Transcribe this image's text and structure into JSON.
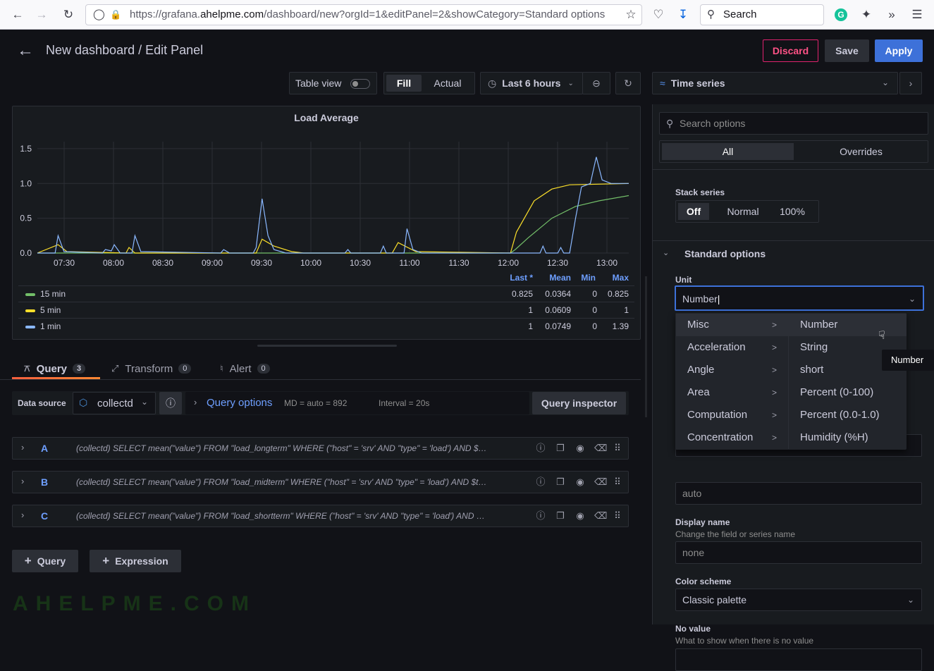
{
  "browser": {
    "url_prefix": "https://grafana.",
    "url_domain": "ahelpme.com",
    "url_path": "/dashboard/new?orgId=1&editPanel=2&showCategory=Standard options",
    "search_placeholder": "Search"
  },
  "header": {
    "title": "New dashboard / Edit Panel",
    "discard": "Discard",
    "save": "Save",
    "apply": "Apply"
  },
  "toolbar": {
    "table_view": "Table view",
    "fill": "Fill",
    "actual": "Actual",
    "time_range": "Last 6 hours",
    "visualization": "Time series"
  },
  "chart_data": {
    "type": "line",
    "title": "Load Average",
    "x_ticks": [
      "07:30",
      "08:00",
      "08:30",
      "09:00",
      "09:30",
      "10:00",
      "10:30",
      "11:00",
      "11:30",
      "12:00",
      "12:30",
      "13:00"
    ],
    "y_ticks": [
      "0.0",
      "0.5",
      "1.0",
      "1.5"
    ],
    "ylim": [
      0,
      1.6
    ],
    "grid": true,
    "legend_placement": "bottom",
    "legend_headers": [
      "Last *",
      "Mean",
      "Min",
      "Max"
    ],
    "series": [
      {
        "name": "15 min",
        "color": "#73bf69",
        "last": "0.825",
        "mean": "0.0364",
        "min": "0",
        "max": "0.825",
        "points": [
          [
            0,
            0
          ],
          [
            0.8,
            0
          ],
          [
            0.808,
            0.05
          ],
          [
            0.83,
            0.22
          ],
          [
            0.87,
            0.5
          ],
          [
            0.91,
            0.67
          ],
          [
            0.95,
            0.75
          ],
          [
            1,
            0.825
          ]
        ]
      },
      {
        "name": "5 min",
        "color": "#fade2a",
        "last": "1",
        "mean": "0.0609",
        "min": "0",
        "max": "1",
        "points": [
          [
            0,
            0
          ],
          [
            0.035,
            0.12
          ],
          [
            0.05,
            0.02
          ],
          [
            0.15,
            0
          ],
          [
            0.155,
            0.08
          ],
          [
            0.165,
            0
          ],
          [
            0.37,
            0
          ],
          [
            0.38,
            0.2
          ],
          [
            0.4,
            0.1
          ],
          [
            0.43,
            0.02
          ],
          [
            0.45,
            0
          ],
          [
            0.6,
            0
          ],
          [
            0.61,
            0.15
          ],
          [
            0.64,
            0.02
          ],
          [
            0.8,
            0
          ],
          [
            0.81,
            0.3
          ],
          [
            0.84,
            0.75
          ],
          [
            0.87,
            0.92
          ],
          [
            0.9,
            0.98
          ],
          [
            1,
            1
          ]
        ]
      },
      {
        "name": "1 min",
        "color": "#8ab8ff",
        "last": "1",
        "mean": "0.0749",
        "min": "0",
        "max": "1.39",
        "points": [
          [
            0,
            0
          ],
          [
            0.03,
            0
          ],
          [
            0.035,
            0.25
          ],
          [
            0.045,
            0.02
          ],
          [
            0.11,
            0
          ],
          [
            0.115,
            0.05
          ],
          [
            0.125,
            0.03
          ],
          [
            0.13,
            0.12
          ],
          [
            0.14,
            0
          ],
          [
            0.16,
            0
          ],
          [
            0.165,
            0.25
          ],
          [
            0.175,
            0.02
          ],
          [
            0.31,
            0
          ],
          [
            0.315,
            0.05
          ],
          [
            0.325,
            0
          ],
          [
            0.365,
            0
          ],
          [
            0.37,
            0.08
          ],
          [
            0.38,
            0.78
          ],
          [
            0.39,
            0.25
          ],
          [
            0.4,
            0.05
          ],
          [
            0.42,
            0
          ],
          [
            0.52,
            0
          ],
          [
            0.525,
            0.05
          ],
          [
            0.53,
            0
          ],
          [
            0.58,
            0
          ],
          [
            0.585,
            0.1
          ],
          [
            0.59,
            0
          ],
          [
            0.62,
            0
          ],
          [
            0.625,
            0.35
          ],
          [
            0.635,
            0.05
          ],
          [
            0.65,
            0
          ],
          [
            0.85,
            0
          ],
          [
            0.855,
            0.1
          ],
          [
            0.86,
            0
          ],
          [
            0.88,
            0
          ],
          [
            0.885,
            0.08
          ],
          [
            0.89,
            0
          ],
          [
            0.9,
            0
          ],
          [
            0.91,
            0.5
          ],
          [
            0.92,
            0.95
          ],
          [
            0.935,
            1.0
          ],
          [
            0.945,
            1.38
          ],
          [
            0.955,
            1.05
          ],
          [
            0.97,
            1.0
          ],
          [
            1,
            1.0
          ]
        ]
      }
    ]
  },
  "query_tabs": [
    {
      "label": "Query",
      "count": "3"
    },
    {
      "label": "Transform",
      "count": "0"
    },
    {
      "label": "Alert",
      "count": "0"
    }
  ],
  "query_bar": {
    "data_source_label": "Data source",
    "data_source": "collectd",
    "query_options": "Query options",
    "md": "MD = auto = 892",
    "interval": "Interval = 20s",
    "inspector": "Query inspector"
  },
  "queries": [
    {
      "letter": "A",
      "text": "(collectd)  SELECT mean(\"value\") FROM \"load_longterm\" WHERE (\"host\" = 'srv' AND \"type\" = 'load') AND $timeFilter GROUP BY time($__interval) fill(null)"
    },
    {
      "letter": "B",
      "text": "(collectd)  SELECT mean(\"value\") FROM \"load_midterm\" WHERE (\"host\" = 'srv' AND \"type\" = 'load') AND $timeFilter GROUP BY time($__interval) fill(null)"
    },
    {
      "letter": "C",
      "text": "(collectd)  SELECT mean(\"value\") FROM \"load_shortterm\" WHERE (\"host\" = 'srv' AND \"type\" = 'load') AND $timeFilter GROUP BY time($__interval) fill(null)"
    }
  ],
  "add_query": "Query",
  "add_expression": "Expression",
  "watermark": "AHELPME.COM",
  "options": {
    "search_placeholder": "Search options",
    "all": "All",
    "overrides": "Overrides",
    "stack_series_label": "Stack series",
    "stack_off": "Off",
    "stack_normal": "Normal",
    "stack_100": "100%",
    "standard_options": "Standard options",
    "unit_label": "Unit",
    "unit_value": "Number",
    "decimals_value": "auto",
    "display_name_label": "Display name",
    "display_name_desc": "Change the field or series name",
    "display_name_placeholder": "none",
    "color_scheme_label": "Color scheme",
    "color_scheme_value": "Classic palette",
    "no_value_label": "No value",
    "no_value_desc": "What to show when there is no value"
  },
  "unit_menu": {
    "categories": [
      "Misc",
      "Acceleration",
      "Angle",
      "Area",
      "Computation",
      "Concentration"
    ],
    "units": [
      "Number",
      "String",
      "short",
      "Percent (0-100)",
      "Percent (0.0-1.0)",
      "Humidity (%H)"
    ],
    "tooltip": "Number"
  }
}
